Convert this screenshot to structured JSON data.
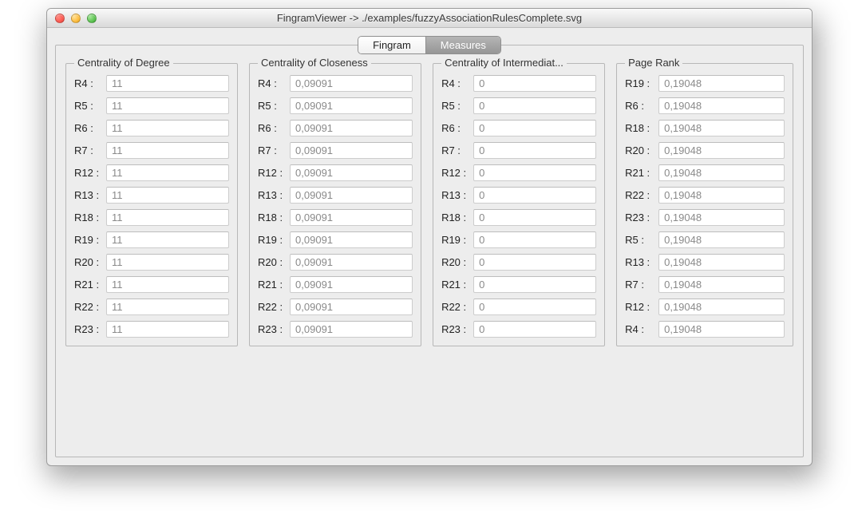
{
  "window": {
    "title": "FingramViewer -> ./examples/fuzzyAssociationRulesComplete.svg"
  },
  "tabs": {
    "fingram": "Fingram",
    "measures": "Measures",
    "selected": "Fingram"
  },
  "groups": {
    "degree": {
      "title": "Centrality of Degree",
      "rows": [
        {
          "label": "R4 :",
          "value": "11"
        },
        {
          "label": "R5 :",
          "value": "11"
        },
        {
          "label": "R6 :",
          "value": "11"
        },
        {
          "label": "R7 :",
          "value": "11"
        },
        {
          "label": "R12 :",
          "value": "11"
        },
        {
          "label": "R13 :",
          "value": "11"
        },
        {
          "label": "R18 :",
          "value": "11"
        },
        {
          "label": "R19 :",
          "value": "11"
        },
        {
          "label": "R20 :",
          "value": "11"
        },
        {
          "label": "R21 :",
          "value": "11"
        },
        {
          "label": "R22 :",
          "value": "11"
        },
        {
          "label": "R23 :",
          "value": "11"
        }
      ]
    },
    "closeness": {
      "title": "Centrality of Closeness",
      "rows": [
        {
          "label": "R4 :",
          "value": "0,09091"
        },
        {
          "label": "R5 :",
          "value": "0,09091"
        },
        {
          "label": "R6 :",
          "value": "0,09091"
        },
        {
          "label": "R7 :",
          "value": "0,09091"
        },
        {
          "label": "R12 :",
          "value": "0,09091"
        },
        {
          "label": "R13 :",
          "value": "0,09091"
        },
        {
          "label": "R18 :",
          "value": "0,09091"
        },
        {
          "label": "R19 :",
          "value": "0,09091"
        },
        {
          "label": "R20 :",
          "value": "0,09091"
        },
        {
          "label": "R21 :",
          "value": "0,09091"
        },
        {
          "label": "R22 :",
          "value": "0,09091"
        },
        {
          "label": "R23 :",
          "value": "0,09091"
        }
      ]
    },
    "intermed": {
      "title": "Centrality of Intermediat...",
      "rows": [
        {
          "label": "R4 :",
          "value": "0"
        },
        {
          "label": "R5 :",
          "value": "0"
        },
        {
          "label": "R6 :",
          "value": "0"
        },
        {
          "label": "R7 :",
          "value": "0"
        },
        {
          "label": "R12 :",
          "value": "0"
        },
        {
          "label": "R13 :",
          "value": "0"
        },
        {
          "label": "R18 :",
          "value": "0"
        },
        {
          "label": "R19 :",
          "value": "0"
        },
        {
          "label": "R20 :",
          "value": "0"
        },
        {
          "label": "R21 :",
          "value": "0"
        },
        {
          "label": "R22 :",
          "value": "0"
        },
        {
          "label": "R23 :",
          "value": "0"
        }
      ]
    },
    "pagerank": {
      "title": "Page Rank",
      "rows": [
        {
          "label": "R19 :",
          "value": "0,19048"
        },
        {
          "label": "R6 :",
          "value": "0,19048"
        },
        {
          "label": "R18 :",
          "value": "0,19048"
        },
        {
          "label": "R20 :",
          "value": "0,19048"
        },
        {
          "label": "R21 :",
          "value": "0,19048"
        },
        {
          "label": "R22 :",
          "value": "0,19048"
        },
        {
          "label": "R23 :",
          "value": "0,19048"
        },
        {
          "label": "R5 :",
          "value": "0,19048"
        },
        {
          "label": "R13 :",
          "value": "0,19048"
        },
        {
          "label": "R7 :",
          "value": "0,19048"
        },
        {
          "label": "R12 :",
          "value": "0,19048"
        },
        {
          "label": "R4 :",
          "value": "0,19048"
        }
      ]
    }
  }
}
